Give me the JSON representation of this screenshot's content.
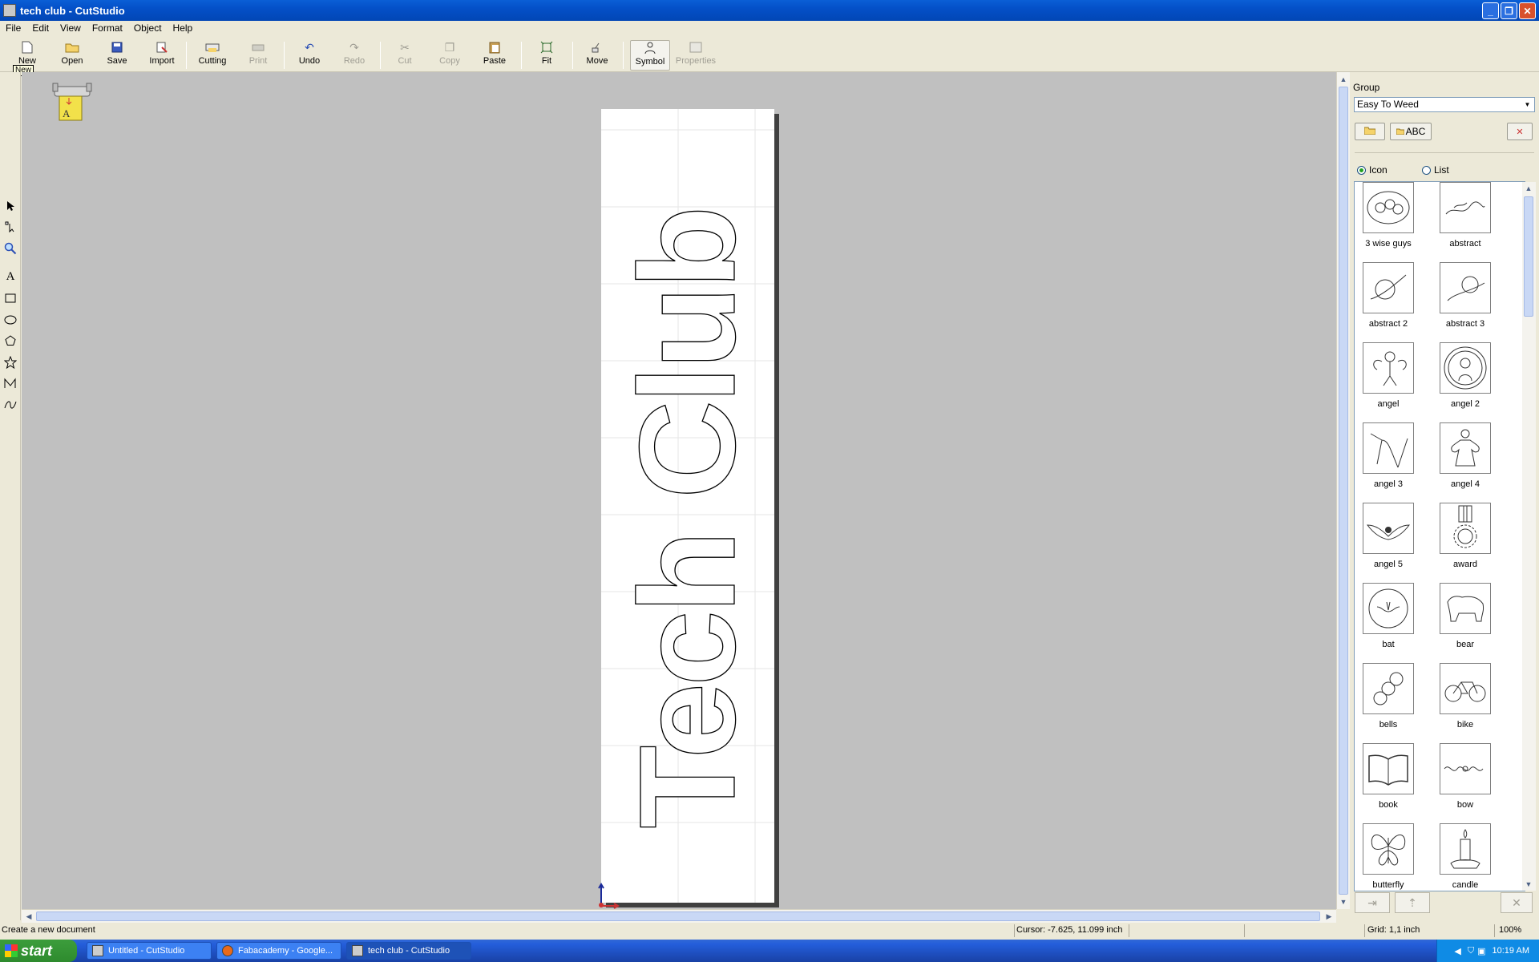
{
  "window": {
    "title": "tech club - CutStudio"
  },
  "menu": [
    "File",
    "Edit",
    "View",
    "Format",
    "Object",
    "Help"
  ],
  "toolbar": {
    "new": "New",
    "open": "Open",
    "save": "Save",
    "import": "Import",
    "cutting": "Cutting",
    "print": "Print",
    "undo": "Undo",
    "redo": "Redo",
    "cut": "Cut",
    "copy": "Copy",
    "paste": "Paste",
    "fit": "Fit",
    "move": "Move",
    "symbol": "Symbol",
    "properties": "Properties"
  },
  "tooltip": "New",
  "document": {
    "text": "Tech Club"
  },
  "panel": {
    "group_label": "Group",
    "group_value": "Easy To Weed",
    "abc_button": "ABC",
    "view_icon": "Icon",
    "view_list": "List",
    "view_selected": "Icon",
    "items": [
      "3 wise guys",
      "abstract",
      "abstract 2",
      "abstract 3",
      "angel",
      "angel 2",
      "angel 3",
      "angel 4",
      "angel 5",
      "award",
      "bat",
      "bear",
      "bells",
      "bike",
      "book",
      "bow",
      "butterfly",
      "candle"
    ]
  },
  "status": {
    "message": "Create a new document",
    "cursor": "Cursor: -7.625, 11.099 inch",
    "grid": "Grid: 1,1 inch",
    "zoom": "100%"
  },
  "taskbar": {
    "start": "start",
    "tasks": [
      "Untitled - CutStudio",
      "Fabacademy - Google...",
      "tech club - CutStudio"
    ],
    "time": "10:19 AM"
  }
}
